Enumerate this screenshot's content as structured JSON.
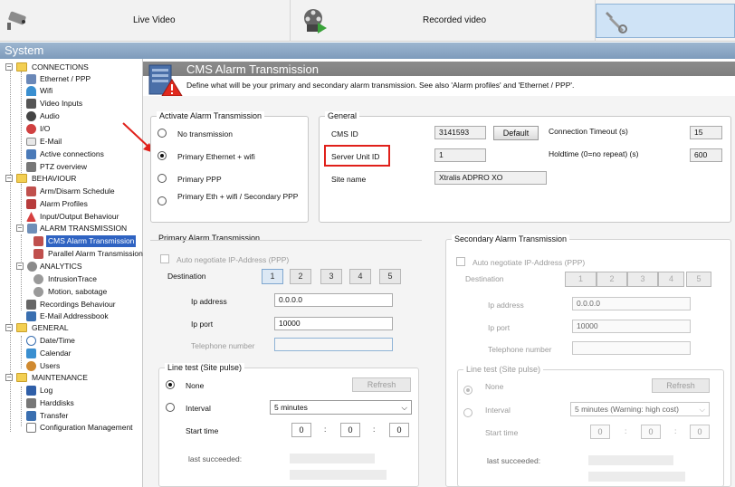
{
  "topbar": {
    "live_video": "Live Video",
    "recorded_video": "Recorded video"
  },
  "system_header": "System",
  "sidebar": {
    "connections": "CONNECTIONS",
    "ethernet": "Ethernet / PPP",
    "wifi": "Wifi",
    "video_inputs": "Video Inputs",
    "audio": "Audio",
    "io": "I/O",
    "email": "E-Mail",
    "active_connections": "Active connections",
    "ptz": "PTZ overview",
    "behaviour": "BEHAVIOUR",
    "arm_disarm": "Arm/Disarm Schedule",
    "alarm_profiles": "Alarm Profiles",
    "io_behaviour": "Input/Output Behaviour",
    "alarm_transmission": "ALARM TRANSMISSION",
    "cms_alarm": "CMS Alarm Transmission",
    "parallel_alarm": "Parallel Alarm Transmission",
    "analytics": "ANALYTICS",
    "intrusion": "IntrusionTrace",
    "motion": "Motion, sabotage",
    "recordings": "Recordings Behaviour",
    "email_book": "E-Mail Addressbook",
    "general": "GENERAL",
    "datetime": "Date/Time",
    "calendar": "Calendar",
    "users": "Users",
    "maintenance": "MAINTENANCE",
    "log": "Log",
    "harddisks": "Harddisks",
    "transfer": "Transfer",
    "config_mgmt": "Configuration Management"
  },
  "panel": {
    "title": "CMS Alarm Transmission",
    "description": "Define what will be your primary and secondary alarm transmission. See also 'Alarm profiles' and 'Ethernet / PPP'."
  },
  "activate": {
    "legend": "Activate Alarm Transmission",
    "options": [
      "No transmission",
      "Primary Ethernet + wifi",
      "Primary PPP",
      "Primary Eth + wifi / Secondary PPP"
    ]
  },
  "general": {
    "legend": "General",
    "cms_id_label": "CMS ID",
    "cms_id": "3141593",
    "default_btn": "Default",
    "server_unit_id_label": "Server Unit ID",
    "server_unit_id": "1",
    "site_name_label": "Site name",
    "site_name": "Xtralis ADPRO XO",
    "conn_timeout_label": "Connection Timeout (s)",
    "conn_timeout": "15",
    "holdtime_label": "Holdtime (0=no repeat) (s)",
    "holdtime": "600"
  },
  "primary": {
    "legend": "Primary Alarm Transmission",
    "auto_negotiate": "Auto negotiate IP-Address (PPP)",
    "destination": "Destination",
    "dest_buttons": [
      "1",
      "2",
      "3",
      "4",
      "5"
    ],
    "ip_label": "Ip address",
    "ip": "0.0.0.0",
    "port_label": "Ip port",
    "port": "10000",
    "tel_label": "Telephone number",
    "line_test": "Line test (Site pulse)",
    "none": "None",
    "refresh": "Refresh",
    "interval": "Interval",
    "interval_value": "5 minutes",
    "start_time": "Start time",
    "h": "0",
    "m": "0",
    "s": "0",
    "last": "last succeeded:"
  },
  "secondary": {
    "legend": "Secondary Alarm Transmission",
    "auto_negotiate": "Auto negotiate IP-Address (PPP)",
    "destination": "Destination",
    "dest_buttons": [
      "1",
      "2",
      "3",
      "4",
      "5"
    ],
    "ip_label": "Ip address",
    "ip": "0.0.0.0",
    "port_label": "Ip port",
    "port": "10000",
    "tel_label": "Telephone number",
    "line_test": "Line test (Site pulse)",
    "none": "None",
    "refresh": "Refresh",
    "interval": "Interval",
    "interval_value": "5 minutes   (Warning: high cost)",
    "start_time": "Start time",
    "h": "0",
    "m": "0",
    "s": "0",
    "last": "last succeeded:"
  },
  "colors": {
    "accent": "#2f63c2",
    "highlight": "#e0201a",
    "arrow": "#e0201a"
  }
}
